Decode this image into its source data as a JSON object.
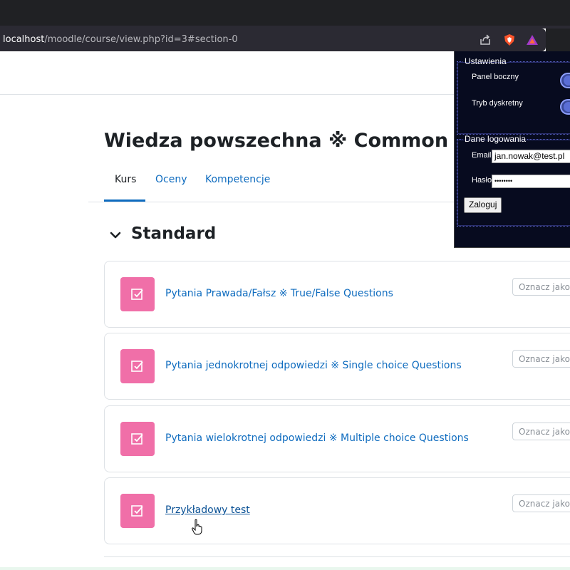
{
  "browser": {
    "url_host": "localhost",
    "url_path": "/moodle/course/view.php?id=3#section-0"
  },
  "course": {
    "title": "Wiedza powszechna ※ Common knowledge",
    "tabs": [
      {
        "label": "Kurs",
        "active": true
      },
      {
        "label": "Oceny",
        "active": false
      },
      {
        "label": "Kompetencje",
        "active": false
      }
    ],
    "section_title": "Standard",
    "activities": [
      {
        "name": "Pytania Prawada/Fałsz ※ True/False Questions",
        "button": "Oznacz jako wykonane"
      },
      {
        "name": "Pytania jednokrotnej odpowiedzi ※ Single choice Questions",
        "button": "Oznacz jako wykonane"
      },
      {
        "name": "Pytania wielokrotnej odpowiedzi ※ Multiple choice Questions",
        "button": "Oznacz jako wykonane"
      },
      {
        "name": "Przykładowy test",
        "button": "Oznacz jako wykonane"
      }
    ],
    "activity_icon_color": "#f06fa8",
    "link_color": "#0f6cbf"
  },
  "panel": {
    "settings_legend": "Ustawienia",
    "sidebar_label": "Panel boczny",
    "discreet_label": "Tryb dyskretny",
    "login_legend": "Dane logowania",
    "email_label": "Email",
    "email_value": "jan.nowak@test.pl",
    "password_label": "Hasło",
    "password_value": "••••••••",
    "login_button": "Zaloguj"
  }
}
